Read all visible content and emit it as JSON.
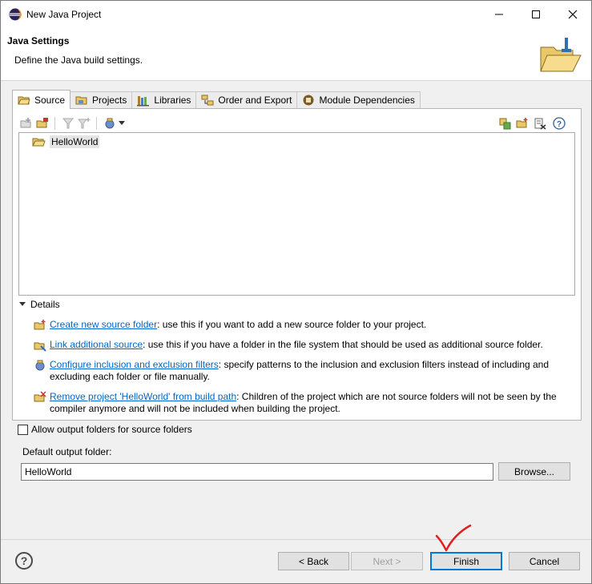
{
  "window": {
    "title": "New Java Project"
  },
  "header": {
    "title": "Java Settings",
    "description": "Define the Java build settings."
  },
  "tabs": [
    {
      "label": "Source",
      "icon": "source-folder-icon",
      "active": true
    },
    {
      "label": "Projects",
      "icon": "projects-icon"
    },
    {
      "label": "Libraries",
      "icon": "libraries-icon"
    },
    {
      "label": "Order and Export",
      "icon": "order-export-icon"
    },
    {
      "label": "Module Dependencies",
      "icon": "module-icon"
    }
  ],
  "tree": {
    "items": [
      {
        "label": "HelloWorld",
        "icon": "project-folder-icon"
      }
    ]
  },
  "details": {
    "heading": "Details",
    "items": [
      {
        "link": "Create new source folder",
        "text": ": use this if you want to add a new source folder to your project."
      },
      {
        "link": "Link additional source",
        "text": ": use this if you have a folder in the file system that should be used as additional source folder."
      },
      {
        "link": "Configure inclusion and exclusion filters",
        "text": ": specify patterns to the inclusion and exclusion filters instead of including and excluding each folder or file manually."
      },
      {
        "link": "Remove project 'HelloWorld' from build path",
        "text": ": Children of the project which are not source folders will not be seen by the compiler anymore and will not be included when building the project."
      }
    ]
  },
  "options": {
    "allow_output_folders_label": "Allow output folders for source folders",
    "allow_output_folders_checked": false,
    "default_output_label": "Default output folder:",
    "default_output_value": "HelloWorld",
    "browse_label": "Browse..."
  },
  "footer": {
    "back_label": "< Back",
    "next_label": "Next >",
    "finish_label": "Finish",
    "cancel_label": "Cancel"
  },
  "colors": {
    "link": "#0066cc",
    "default_button_border": "#0078d7",
    "annotation": "#e02020"
  }
}
